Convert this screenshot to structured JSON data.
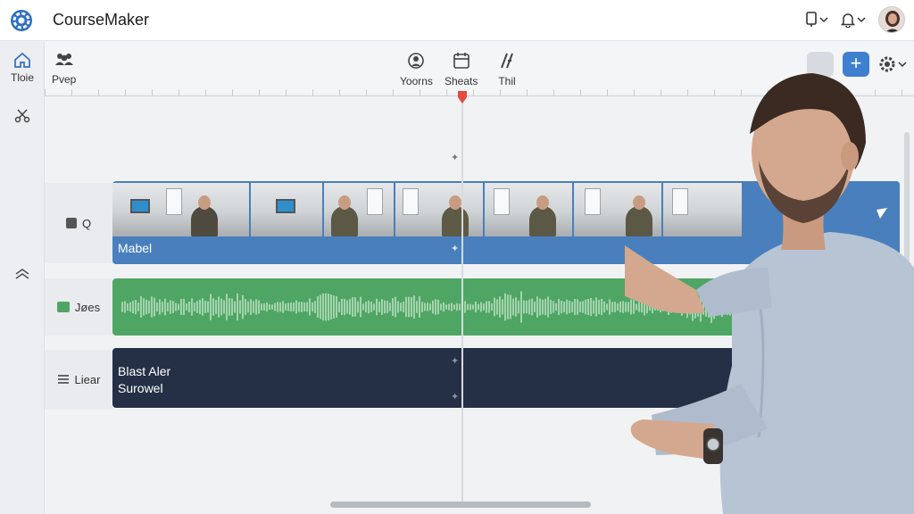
{
  "app": {
    "title": "CourseMaker"
  },
  "rail": {
    "home_label": "Tloie"
  },
  "toolbar": {
    "preview_label": "Pvep",
    "tools": [
      {
        "label": "Yoorns",
        "icon": "smile-icon"
      },
      {
        "label": "Sheats",
        "icon": "sheets-icon"
      },
      {
        "label": "Thil",
        "icon": "trim-icon"
      }
    ]
  },
  "tracks": {
    "video": {
      "side_label": "Q",
      "clip_label": "Mabel"
    },
    "audio": {
      "side_label": "Jøes"
    },
    "text": {
      "side_label": "Liear",
      "line1": "Blast Aler",
      "line2": "Surowel"
    }
  },
  "colors": {
    "accent": "#3f7fd0",
    "video_track": "#4a7fbd",
    "audio_track": "#4fa664",
    "text_track": "#253046",
    "playhead": "#e34b3e"
  }
}
